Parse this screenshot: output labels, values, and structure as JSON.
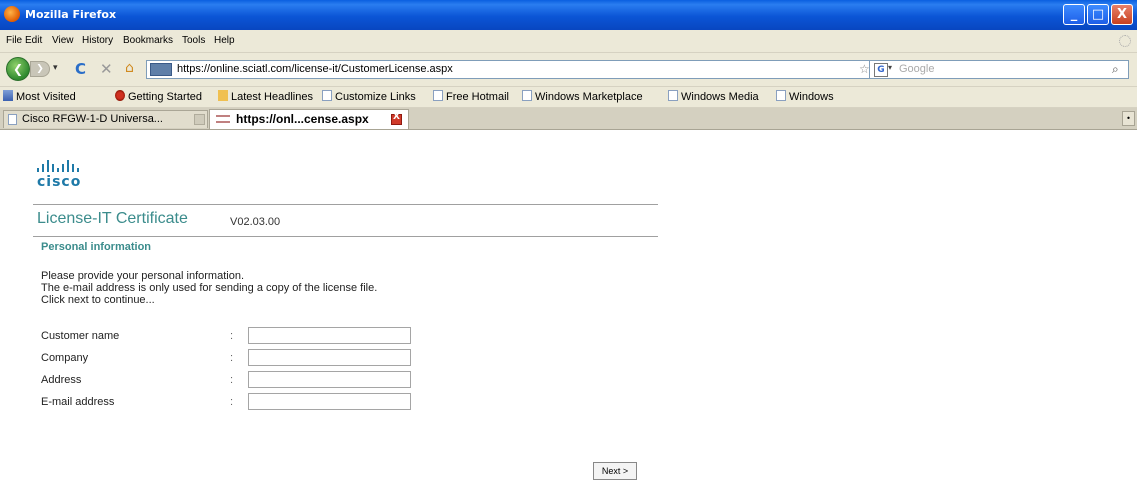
{
  "window": {
    "title": "Mozilla Firefox",
    "controls": {
      "minimize": "_",
      "maximize": "□",
      "close": "X"
    }
  },
  "menu": [
    "File",
    "Edit",
    "View",
    "History",
    "Bookmarks",
    "Tools",
    "Help"
  ],
  "navbar": {
    "url": "https://online.sciatl.com/license-it/CustomerLicense.aspx",
    "search_placeholder": "Google",
    "search_engine_icon": "G",
    "icons": {
      "back": "back-arrow-icon",
      "forward": "forward-arrow-icon",
      "reload": "reload-icon",
      "stop": "stop-icon",
      "home": "home-icon",
      "star": "star-icon",
      "search_go": "magnifier-icon"
    },
    "glyphs": {
      "back": "❮",
      "forward": "❯",
      "dropdown": "▾",
      "reload": "C",
      "stop": "✕",
      "home": "⌂",
      "star": "☆",
      "search_go": "⌕"
    }
  },
  "bookmarks": [
    {
      "label": "Most Visited",
      "icon": "mv"
    },
    {
      "label": "Getting Started",
      "icon": "red"
    },
    {
      "label": "Latest Headlines",
      "icon": "feed"
    },
    {
      "label": "Customize Links",
      "icon": "page"
    },
    {
      "label": "Free Hotmail",
      "icon": "page"
    },
    {
      "label": "Windows Marketplace",
      "icon": "page"
    },
    {
      "label": "Windows Media",
      "icon": "page"
    },
    {
      "label": "Windows",
      "icon": "page"
    }
  ],
  "tabs": [
    {
      "label": "Cisco RFGW-1-D Universa...",
      "active": false
    },
    {
      "label": "https://onl...cense.aspx",
      "active": true
    }
  ],
  "page": {
    "logo_text": "cisco",
    "title": "License-IT Certificate",
    "version": "V02.03.00",
    "section_title": "Personal information",
    "intro": [
      "Please provide your personal information.",
      "The e-mail address is only used for sending a copy of the license file.",
      "Click next to continue..."
    ],
    "fields": [
      {
        "label": "Customer name",
        "colon": ":",
        "value": ""
      },
      {
        "label": "Company",
        "colon": ":",
        "value": ""
      },
      {
        "label": "Address",
        "colon": ":",
        "value": ""
      },
      {
        "label": "E-mail address",
        "colon": ":",
        "value": ""
      }
    ],
    "next_label": "Next >"
  },
  "colors": {
    "titlebar": "#0b55d6",
    "chrome": "#ece9d8",
    "accent_teal": "#3b8c8c",
    "cisco_blue": "#1f7aa8"
  }
}
